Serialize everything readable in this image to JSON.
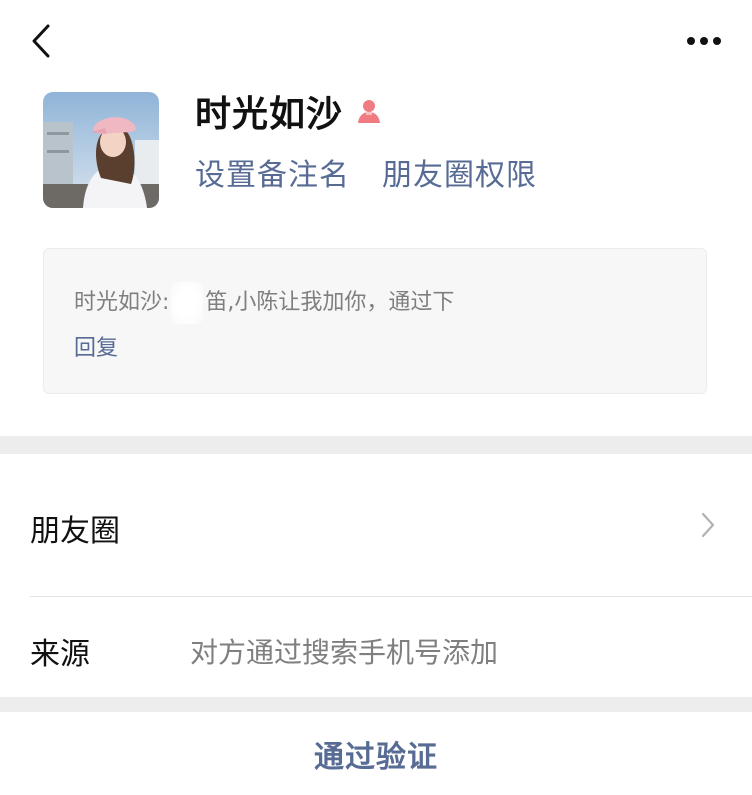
{
  "header": {
    "back_icon": "chevron-left-icon",
    "more_icon": "more-horizontal-icon"
  },
  "profile": {
    "nickname": "时光如沙",
    "gender_icon": "female-person-icon",
    "gender_color": "#f07c82",
    "set_remark_label": "设置备注名",
    "moments_permission_label": "朋友圈权限"
  },
  "verification": {
    "sender": "时光如沙:",
    "message": "笛,小陈让我加你，通过下",
    "reply_label": "回复"
  },
  "rows": {
    "moments_label": "朋友圈",
    "source_label": "来源",
    "source_value": "对方通过搜索手机号添加"
  },
  "actions": {
    "accept_label": "通过验证"
  },
  "colors": {
    "link": "#576b95",
    "background_gap": "#ededed",
    "secondary_text": "#7f7f7f"
  }
}
